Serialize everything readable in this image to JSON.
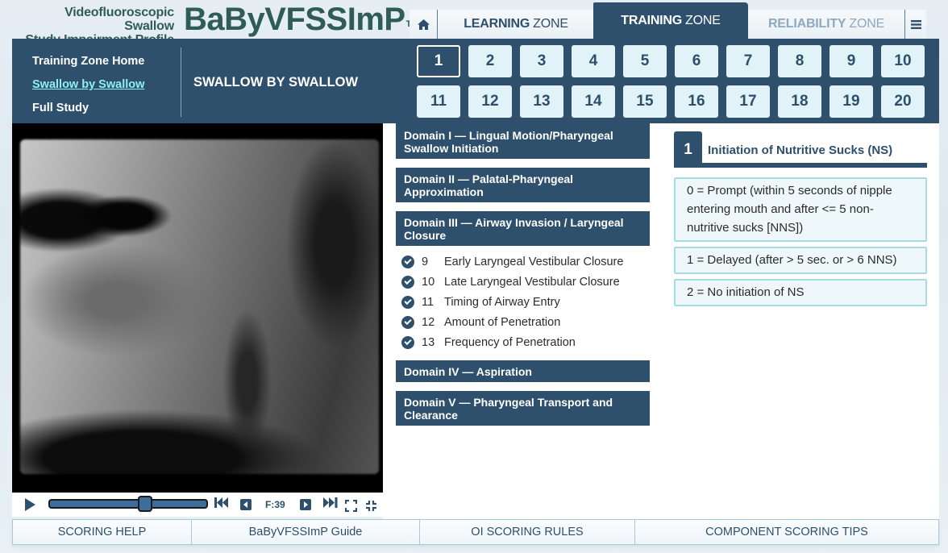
{
  "header": {
    "logo_subtitle_line1": "Videofluoroscopic Swallow",
    "logo_subtitle_line2": "Study Impairment Profile",
    "logo_title": "BaByVFSSImP",
    "logo_trademark": "TM"
  },
  "nav": {
    "home_icon": "home-icon",
    "tabs": [
      {
        "bold": "LEARNING",
        "rest": "ZONE",
        "state": "normal"
      },
      {
        "bold": "TRAINING",
        "rest": "ZONE",
        "state": "active"
      },
      {
        "bold": "RELIABILITY",
        "rest": "ZONE",
        "state": "disabled"
      }
    ],
    "menu_icon": "hamburger-menu-icon"
  },
  "sidebar": {
    "links": [
      {
        "label": "Training Zone Home",
        "active": false
      },
      {
        "label": "Swallow by Swallow",
        "active": true
      },
      {
        "label": "Full Study",
        "active": false
      }
    ]
  },
  "section_title": "SWALLOW BY SWALLOW",
  "swallows": {
    "selected": "1",
    "buttons": [
      "1",
      "2",
      "3",
      "4",
      "5",
      "6",
      "7",
      "8",
      "9",
      "10",
      "11",
      "12",
      "13",
      "14",
      "15",
      "16",
      "17",
      "18",
      "19",
      "20"
    ]
  },
  "player": {
    "frame_label": "F:39",
    "progress_fraction": 0.62,
    "icons": [
      "play-icon",
      "skip-to-start-icon",
      "step-back-icon",
      "step-forward-icon",
      "skip-to-end-icon",
      "fullscreen-icon",
      "exit-fullscreen-icon"
    ]
  },
  "domains": [
    {
      "label": "Domain I — Lingual Motion/Pharyngeal Swallow Initiation",
      "expanded": false,
      "items": []
    },
    {
      "label": "Domain II — Palatal-Pharyngeal Approximation",
      "expanded": false,
      "items": []
    },
    {
      "label": "Domain III — Airway Invasion / Laryngeal Closure",
      "expanded": true,
      "items": [
        {
          "num": "9",
          "label": "Early Laryngeal Vestibular Closure",
          "checked": true
        },
        {
          "num": "10",
          "label": "Late Laryngeal Vestibular Closure",
          "checked": true
        },
        {
          "num": "11",
          "label": "Timing of Airway Entry",
          "checked": true
        },
        {
          "num": "12",
          "label": "Amount of Penetration",
          "checked": true
        },
        {
          "num": "13",
          "label": "Frequency of Penetration",
          "checked": true
        }
      ]
    },
    {
      "label": "Domain IV — Aspiration",
      "expanded": false,
      "items": []
    },
    {
      "label": "Domain V — Pharyngeal Transport and Clearance",
      "expanded": false,
      "items": []
    }
  ],
  "component": {
    "number": "1",
    "title": "Initiation of Nutritive Sucks (NS)",
    "options": [
      "0 = Prompt (within 5 seconds of nipple entering mouth and after <= 5 non-nutritive sucks [NNS])",
      "1 = Delayed (after > 5 sec. or > 6 NNS)",
      "2 = No initiation of NS"
    ]
  },
  "bottom_bar": {
    "buttons": [
      "SCORING HELP",
      "BaByVFSSImP Guide",
      "OI SCORING RULES",
      "COMPONENT SCORING TIPS"
    ]
  },
  "colors": {
    "primary_navy": "#2e506c",
    "logo_green": "#2f5d55",
    "active_link": "#8ff0f0",
    "swallow_button_bg": "#dff3f8",
    "option_bg": "#eef8fa",
    "option_border": "#a9dbe0",
    "disabled_tab": "#8ea8bd"
  }
}
